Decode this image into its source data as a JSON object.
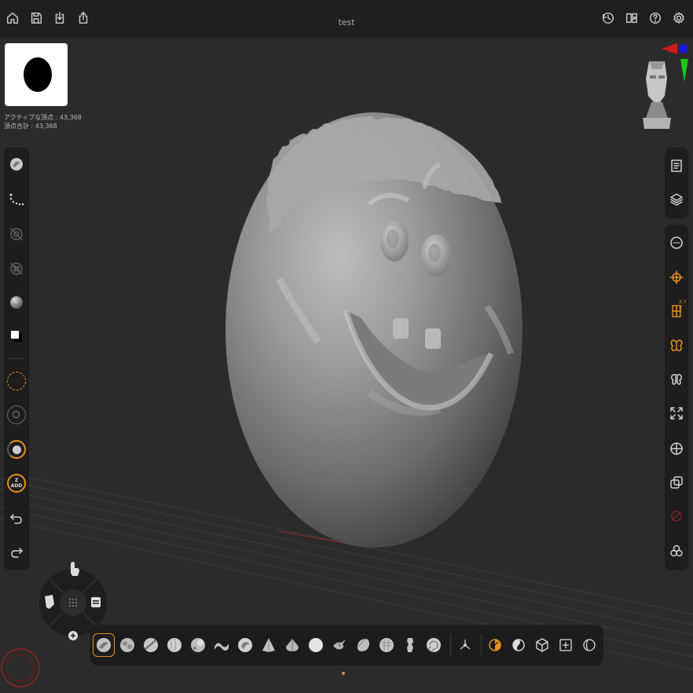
{
  "app": {
    "title": "test"
  },
  "stats": {
    "active_vertices": "アクティブな頂点 : 43,368",
    "total_vertices": "頂点合計 : 43,368"
  },
  "left_toolbar": {
    "items": [
      "clay-brush-icon",
      "stroke-dots-icon",
      "lazy-mouse-icon",
      "grid-snap-icon",
      "material-sphere-icon",
      "color-swatch-icon",
      "focal-shift-ring",
      "draw-size-ring",
      "intensity-ring",
      "z-add-toggle",
      "undo-icon",
      "redo-icon"
    ],
    "z_add_label": "Z",
    "z_add_sublabel": "ADD"
  },
  "right_toolbar": {
    "items": [
      "documents-icon",
      "layers-icon",
      "dynamesh-icon",
      "transform-icon",
      "symmetry-xyz-icon",
      "mirror-icon",
      "mirror-dup-icon",
      "frame-icon",
      "perspective-icon",
      "duplicate-icon",
      "polyframe-icon",
      "subtools-icon"
    ],
    "xyz_badge": "X Y Z"
  },
  "bottom_brushes": [
    "clay-buildup",
    "clay",
    "standard",
    "smooth",
    "inflate",
    "snakehook",
    "move",
    "pinch",
    "trim",
    "polish",
    "damstandard",
    "planar",
    "hpolish",
    "orb-cracks",
    "curve"
  ],
  "colors": {
    "accent": "#e8901c",
    "panel": "#1d1d1d",
    "background": "#2b2b2b",
    "topbar": "#1f1f1f"
  }
}
